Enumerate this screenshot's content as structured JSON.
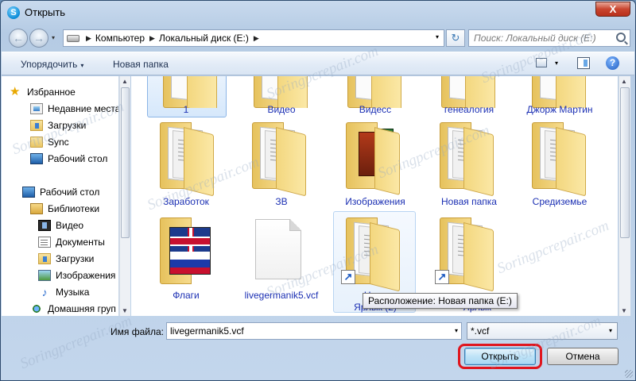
{
  "window": {
    "title": "Открыть",
    "close_glyph": "X",
    "app_icon_glyph": "S"
  },
  "nav": {
    "back_glyph": "←",
    "forward_glyph": "→",
    "dropdown_glyph": "▾",
    "refresh_glyph": "↻"
  },
  "address": {
    "crumbs": [
      "Компьютер",
      "Локальный диск (E:)"
    ],
    "arrow_glyph": "▶",
    "dropdown_glyph": "▾"
  },
  "search": {
    "placeholder": "Поиск: Локальный диск (E:)"
  },
  "toolbar": {
    "organize_label": "Упорядочить",
    "new_folder_label": "Новая папка",
    "dropdown_glyph": "▾",
    "help_glyph": "?"
  },
  "sidebar": {
    "favorites": [
      {
        "label": "Избранное",
        "icon": "star-icon"
      },
      {
        "label": "Недавние места",
        "icon": "recent-places-icon"
      },
      {
        "label": "Загрузки",
        "icon": "downloads-folder-icon"
      },
      {
        "label": "Sync",
        "icon": "folder-icon"
      },
      {
        "label": "Рабочий стол",
        "icon": "desktop-icon"
      }
    ],
    "desktop": [
      {
        "label": "Рабочий стол",
        "icon": "desktop-icon"
      },
      {
        "label": "Библиотеки",
        "icon": "libraries-icon"
      },
      {
        "label": "Видео",
        "icon": "video-icon"
      },
      {
        "label": "Документы",
        "icon": "documents-icon"
      },
      {
        "label": "Загрузки",
        "icon": "downloads-folder-icon"
      },
      {
        "label": "Изображения",
        "icon": "images-icon"
      },
      {
        "label": "Музыка",
        "icon": "music-icon"
      },
      {
        "label": "Домашняя груп",
        "icon": "homegroup-icon"
      }
    ],
    "star_glyph": "★",
    "music_glyph": "♪",
    "scroll_up": "▲",
    "scroll_down": "▼"
  },
  "files": {
    "row1": [
      "1",
      "Видео",
      "Видесс",
      "генеалогия",
      "Джорж Мартин"
    ],
    "row2": [
      "Заработок",
      "ЗВ",
      "Изображения",
      "Новая папка",
      "Средиземье"
    ],
    "row3": [
      "Флаги",
      "livegermanik5.vcf",
      "Нова",
      "Ярлык (2)",
      "Ярлык"
    ],
    "shortcut_glyph": "↗"
  },
  "tooltip": {
    "text": "Расположение: Новая папка (E:)"
  },
  "bottom": {
    "filename_label": "Имя файла:",
    "filename_value": "livegermanik5.vcf",
    "filter_value": "*.vcf",
    "open_label": "Открыть",
    "cancel_label": "Отмена",
    "dropdown_glyph": "▾"
  },
  "watermark": {
    "text": "Soringpcrepair.com"
  }
}
